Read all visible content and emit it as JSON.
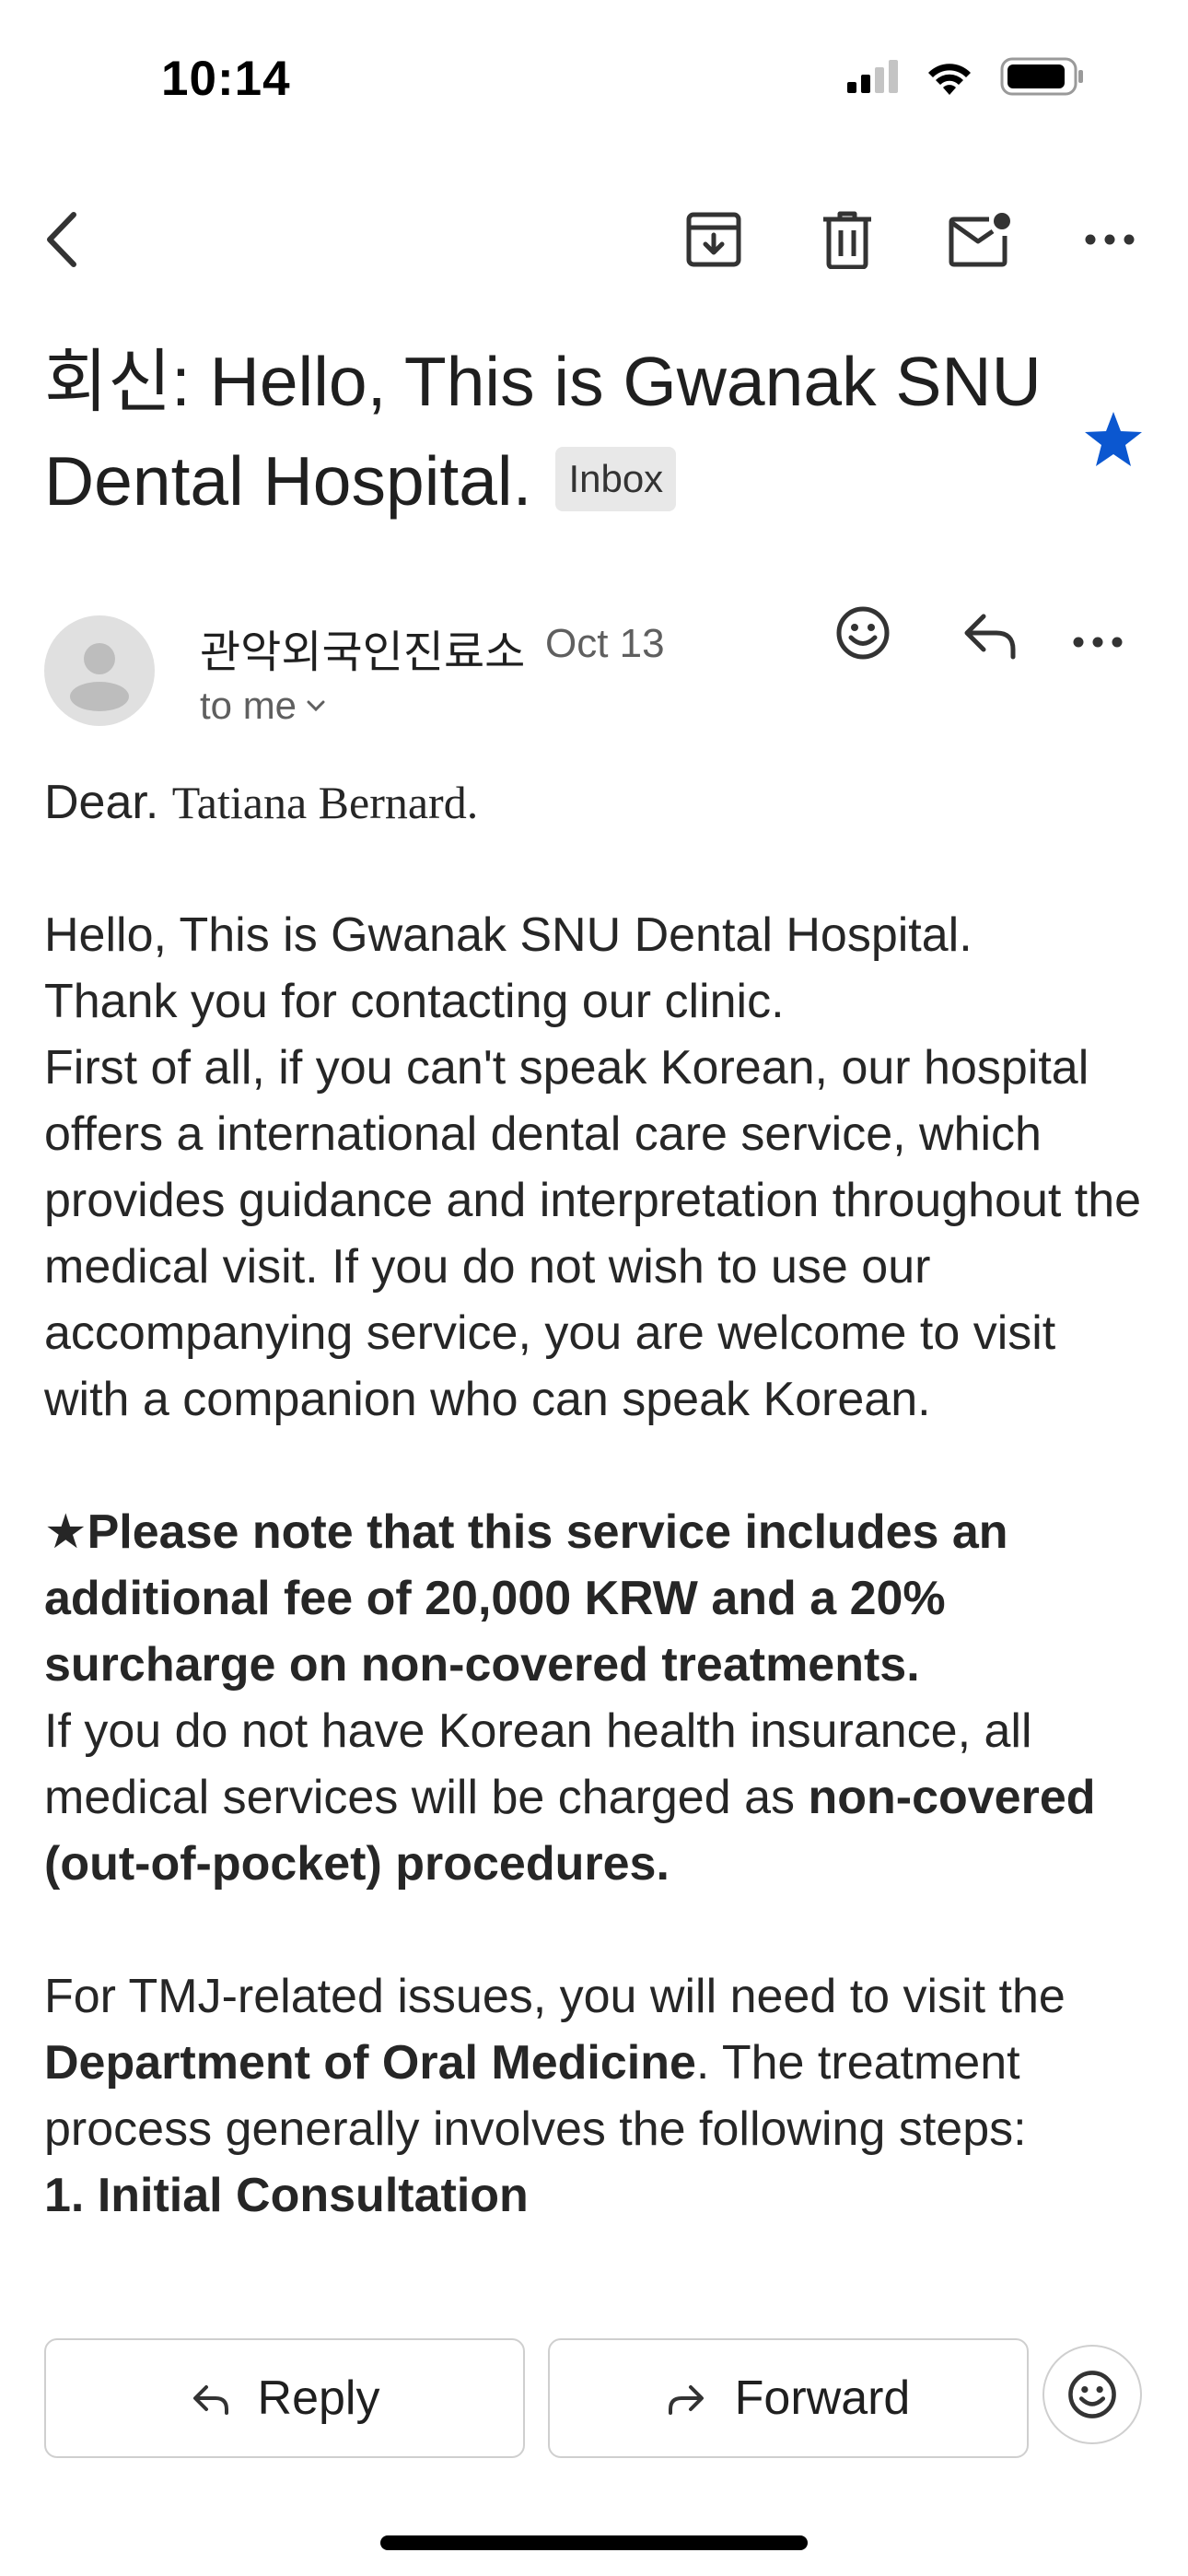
{
  "status_bar": {
    "time": "10:14"
  },
  "toolbar": {
    "icons": [
      "back-icon",
      "archive-icon",
      "trash-icon",
      "mark-unread-icon",
      "more-icon"
    ]
  },
  "email": {
    "subject": "회신: Hello, This is Gwanak SNU Dental Hospital.",
    "label": "Inbox",
    "starred": true,
    "star_color": "#0b57d0",
    "sender": "관악외국인진료소",
    "date": "Oct 13",
    "recipient": "to me"
  },
  "body": {
    "greeting": "Dear.",
    "greeting_name": "Tatiana Bernard.",
    "p1": "Hello, This is Gwanak SNU Dental Hospital.",
    "p2": "Thank you for contacting our clinic.",
    "p3": "First of all, if you can't speak Korean, our hospital offers a international dental care service, which provides guidance and interpretation throughout the medical visit. If you do not wish to use our accompanying service, you are welcome to visit with a companion who can speak Korean.",
    "note_bold": "★Please note that this service includes an additional fee of 20,000 KRW and a 20% surcharge on non-covered treatments.",
    "insurance_pre": "If you do not have Korean health insurance, all medical services will be charged as ",
    "insurance_bold": "non-covered (out-of-pocket) procedures.",
    "tmj_pre": "For TMJ-related issues, you will need to visit the ",
    "tmj_bold": "Department of Oral Medicine",
    "tmj_post": ". The treatment process generally involves the following steps:",
    "step1": "1. Initial Consultation"
  },
  "actions": {
    "reply": "Reply",
    "forward": "Forward"
  }
}
